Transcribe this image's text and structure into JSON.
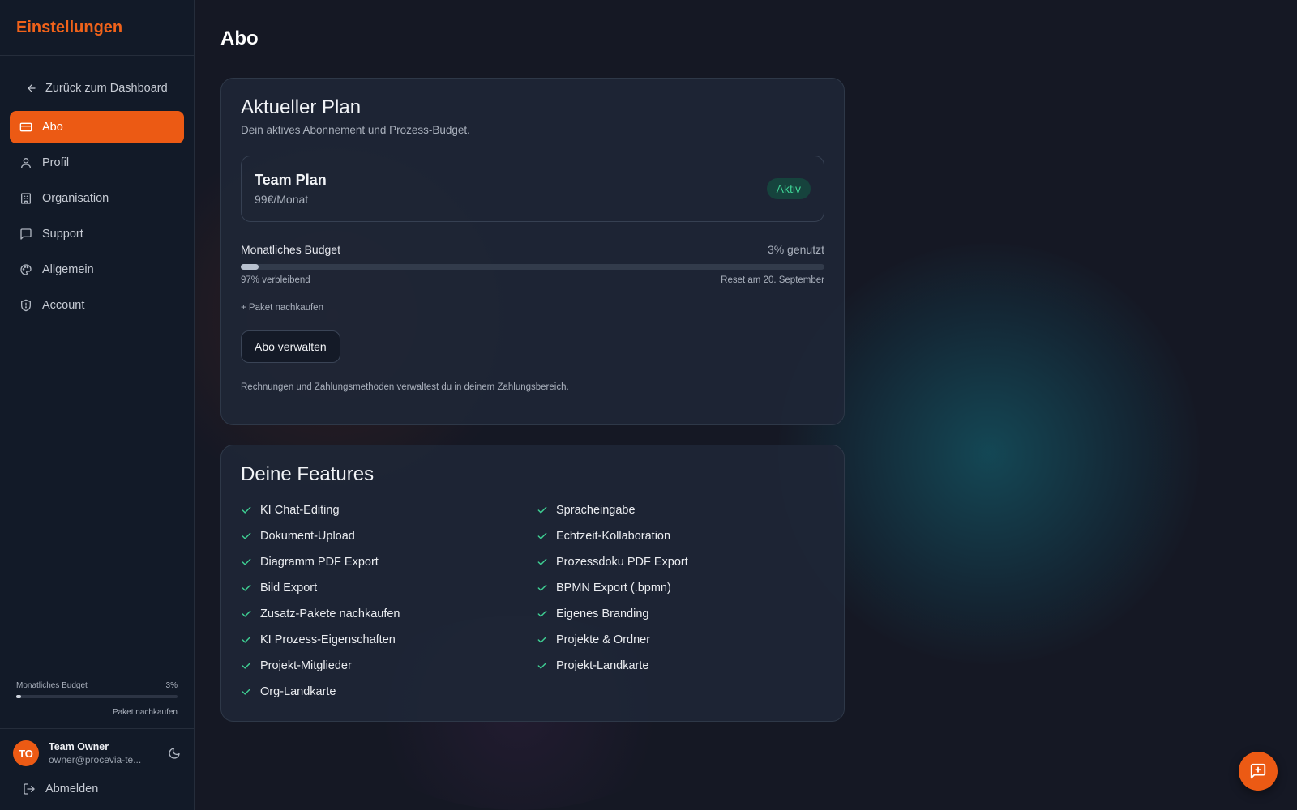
{
  "colors": {
    "accent": "#ec5a14",
    "success": "#3ecf93",
    "background": "#151824",
    "sidebar": "#121a28"
  },
  "sidebar": {
    "title": "Einstellungen",
    "back_label": "Zurück zum Dashboard",
    "items": [
      {
        "label": "Abo",
        "icon": "credit-card-icon",
        "active": true
      },
      {
        "label": "Profil",
        "icon": "user-icon",
        "active": false
      },
      {
        "label": "Organisation",
        "icon": "building-icon",
        "active": false
      },
      {
        "label": "Support",
        "icon": "message-square-icon",
        "active": false
      },
      {
        "label": "Allgemein",
        "icon": "palette-icon",
        "active": false
      },
      {
        "label": "Account",
        "icon": "shield-icon",
        "active": false
      }
    ],
    "budget": {
      "label": "Monatliches Budget",
      "percent_text": "3%",
      "used_fraction": 0.03,
      "link": "Paket nachkaufen"
    },
    "user": {
      "initials": "TO",
      "name": "Team Owner",
      "email": "owner@procevia-te..."
    },
    "logout_label": "Abmelden"
  },
  "main": {
    "title": "Abo",
    "plan_card": {
      "title": "Aktueller Plan",
      "subtitle": "Dein aktives Abonnement und Prozess-Budget.",
      "plan_name": "Team Plan",
      "plan_price": "99€/Monat",
      "status_badge": "Aktiv",
      "budget_label": "Monatliches Budget",
      "budget_used_text": "3% genutzt",
      "budget_used_fraction": 0.03,
      "remaining_text": "97% verbleibend",
      "reset_text": "Reset am 20. September",
      "buy_link": "+ Paket nachkaufen",
      "manage_button": "Abo verwalten",
      "footnote": "Rechnungen und Zahlungsmethoden verwaltest du in deinem Zahlungsbereich."
    },
    "features_card": {
      "title": "Deine Features",
      "features": [
        "KI Chat-Editing",
        "Spracheingabe",
        "Dokument-Upload",
        "Echtzeit-Kollaboration",
        "Diagramm PDF Export",
        "Prozessdoku PDF Export",
        "Bild Export",
        "BPMN Export (.bpmn)",
        "Zusatz-Pakete nachkaufen",
        "Eigenes Branding",
        "KI Prozess-Eigenschaften",
        "Projekte & Ordner",
        "Projekt-Mitglieder",
        "Projekt-Landkarte",
        "Org-Landkarte"
      ]
    }
  },
  "chat_button_icon": "message-plus-icon"
}
